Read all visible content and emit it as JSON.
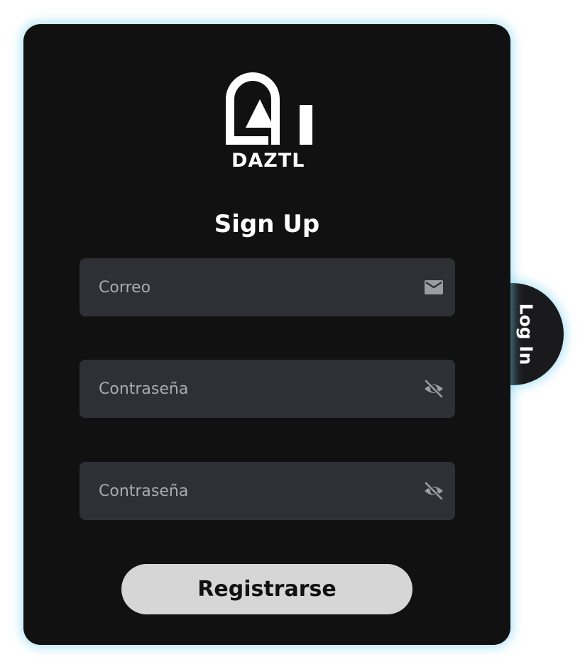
{
  "brand": {
    "name": "DAZTL"
  },
  "form": {
    "title": "Sign Up",
    "fields": [
      {
        "placeholder": "Correo",
        "value": "",
        "icon": "envelope-icon"
      },
      {
        "placeholder": "Contraseña",
        "value": "",
        "icon": "eye-slash-icon"
      },
      {
        "placeholder": "Contraseña",
        "value": "",
        "icon": "eye-slash-icon"
      }
    ],
    "submit_label": "Registrarse"
  },
  "side_tab": {
    "label": "Log In"
  },
  "colors": {
    "card_background": "#111111",
    "field_background": "#2d3035",
    "button_background": "#d6d6d6",
    "glow": "#78d2f0",
    "icon_color": "#9a9da2"
  }
}
